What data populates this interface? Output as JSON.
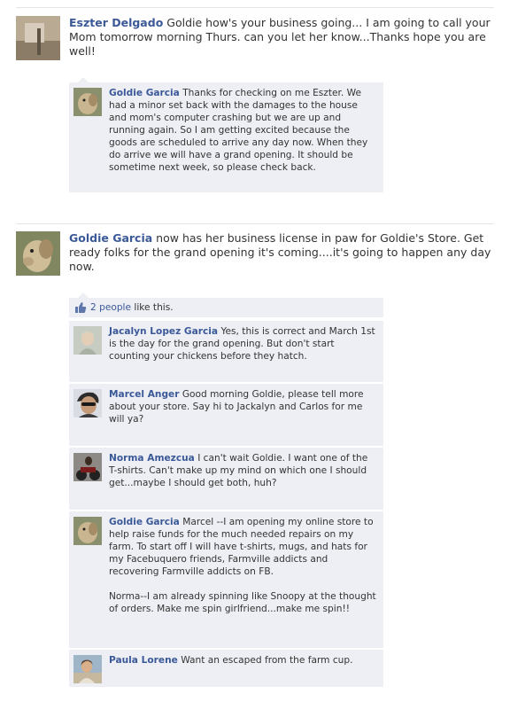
{
  "posts": [
    {
      "author": "Eszter Delgado",
      "text": "Goldie how's your business going... I am going to call your Mom tomorrow morning Thurs. can you let her know...Thanks hope you are well!",
      "comments": [
        {
          "author": "Goldie Garcia",
          "text": "Thanks for checking on me Eszter. We had a minor set back with the damages to the house and mom's computer crashing but we are up and running again. So I am getting excited because the goods are scheduled to arrive any day now. When they do arrive we will have a grand opening. It should be sometime next week, so please check back."
        }
      ]
    },
    {
      "author": "Goldie Garcia",
      "text": "now has her business license in paw for Goldie's Store. Get ready folks for the grand opening it's coming....it's going to happen any day now.",
      "likes": {
        "count_link": "2 people",
        "suffix": " like this."
      },
      "comments": [
        {
          "author": "Jacalyn Lopez Garcia",
          "text": "Yes, this is correct and March 1st is the day for the grand opening. But don't start counting your chickens before they hatch."
        },
        {
          "author": "Marcel Anger",
          "text": "Good morning Goldie, please tell more about your store. Say hi to Jackalyn and Carlos for me will ya?"
        },
        {
          "author": "Norma Amezcua",
          "text": "I can't wait Goldie. I want one of the T-shirts. Can't make up my mind on which one I should get...maybe I should get both, huh?"
        },
        {
          "author": "Goldie Garcia",
          "text": "Marcel --I am opening my online store to help raise funds for the much needed repairs on my farm. To start off I will have t-shirts, mugs, and hats for my Facebuquero friends, Farmville addicts and recovering Farmville addicts on FB.\n\nNorma--I am already spinning like Snoopy at the thought of orders. Make me spin girlfriend...make me spin!!"
        },
        {
          "author": "Paula Lorene",
          "text": "Want an escaped from the farm cup."
        }
      ]
    }
  ],
  "colors": {
    "link": "#3b5998",
    "comment_bg": "#edeff4"
  },
  "icons": {
    "like": "thumbs-up-icon"
  }
}
